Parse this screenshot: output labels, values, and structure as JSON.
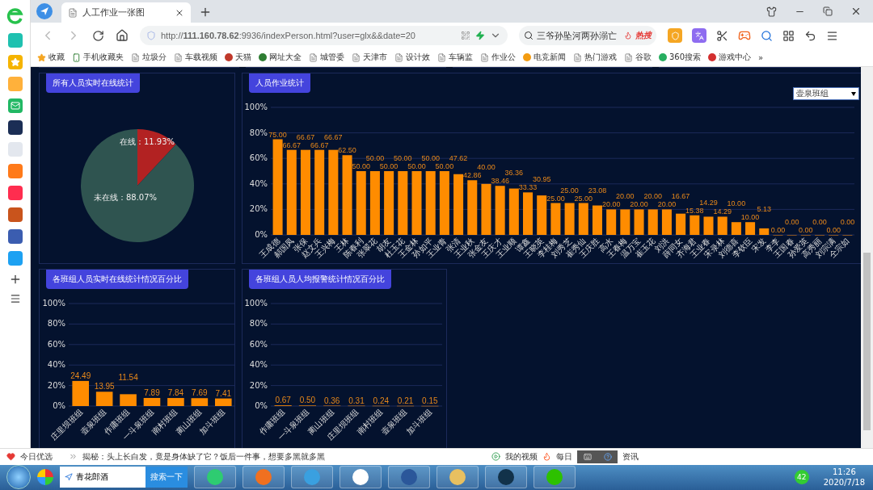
{
  "browser": {
    "tab": {
      "title": "人工作业一张图"
    },
    "address": "http://**111.160.78.62**:9936/indexPerson.html?user=glx&&date=20",
    "search": {
      "value": "三爷孙坠河两孙溺亡",
      "badge": "热搜"
    },
    "bookmarks": [
      {
        "kind": "star",
        "label": "收藏"
      },
      {
        "kind": "phone",
        "label": "手机收藏夹"
      },
      {
        "kind": "page",
        "label": "垃圾分"
      },
      {
        "kind": "page",
        "label": "车载视频"
      },
      {
        "kind": "site",
        "label": "天猫",
        "color": "#c0392b"
      },
      {
        "kind": "site",
        "label": "网址大全",
        "color": "#2e7d32"
      },
      {
        "kind": "page",
        "label": "城管委"
      },
      {
        "kind": "page",
        "label": "天津市"
      },
      {
        "kind": "page",
        "label": "设计效"
      },
      {
        "kind": "page",
        "label": "车辆监"
      },
      {
        "kind": "page",
        "label": "作业公"
      },
      {
        "kind": "site",
        "label": "电竞新闻",
        "color": "#f39c12"
      },
      {
        "kind": "page",
        "label": "热门游戏"
      },
      {
        "kind": "page",
        "label": "谷歌"
      },
      {
        "kind": "site",
        "label": "360搜索",
        "color": "#27ae60"
      },
      {
        "kind": "site",
        "label": "游戏中心",
        "color": "#d32f2f"
      }
    ],
    "more": "»"
  },
  "pie_panel": {
    "title": "所有人员实时在线统计",
    "chart_data": {
      "type": "pie",
      "categories": [
        "在线：11.93%",
        "未在线：88.07%"
      ],
      "values": [
        11.93,
        88.07
      ]
    }
  },
  "bar_panel": {
    "title": "人员作业统计",
    "select": {
      "value": "壶泉班组"
    },
    "chart_data": {
      "type": "bar",
      "grid": true,
      "ylim": [
        0,
        100
      ],
      "yticks": [
        {
          "value": 0,
          "label": "0%"
        },
        {
          "value": 20,
          "label": "20%"
        },
        {
          "value": 40,
          "label": "40%"
        },
        {
          "value": 60,
          "label": "60%"
        },
        {
          "value": 80,
          "label": "80%"
        },
        {
          "value": 100,
          "label": "100%"
        }
      ],
      "categories": [
        "王成德",
        "郝国凤",
        "张保",
        "赵文兵",
        "王兴梅",
        "王林",
        "陈春利",
        "张翠花",
        "胡友",
        "杜玉花",
        "王金林",
        "孙如平",
        "王业青",
        "张清",
        "王业秋",
        "张金友",
        "王庆才",
        "王业顺",
        "谭鑫",
        "王晓英",
        "李桂梅",
        "刘秀芝",
        "崔秀仙",
        "王庆胜",
        "高水",
        "王春梅",
        "温万宝",
        "崔玉花",
        "刘洪",
        "薛同女",
        "齐海君",
        "王业春",
        "宋录林",
        "刘德喜",
        "李钦臣",
        "宋发",
        "李李",
        "王国春",
        "孙爱英",
        "高秀丽",
        "刘宗满",
        "仝宗如"
      ],
      "values": [
        75.0,
        66.67,
        66.67,
        66.67,
        66.67,
        62.5,
        50.0,
        50.0,
        50.0,
        50.0,
        50.0,
        50.0,
        50.0,
        47.62,
        42.86,
        40.0,
        38.46,
        36.36,
        33.33,
        30.95,
        25.0,
        25.0,
        25.0,
        23.08,
        20.0,
        20.0,
        20.0,
        20.0,
        20.0,
        16.67,
        15.38,
        14.29,
        14.29,
        10.0,
        10.0,
        5.13,
        0.0,
        0.0,
        0.0,
        0.0,
        0.0,
        0.0
      ],
      "value_labels": [
        "75.00",
        "66.67",
        "66.67",
        "66.67",
        "66.67",
        "62.50",
        "50.00",
        "50.00",
        "50.00",
        "50.00",
        "50.00",
        "50.00",
        "50.00",
        "47.62",
        "42.86",
        "40.00",
        "38.46",
        "36.36",
        "33.33",
        "30.95",
        "25.00",
        "25.00",
        "25.00",
        "23.08",
        "20.00",
        "20.00",
        "20.00",
        "20.00",
        "20.00",
        "16.67",
        "15.38",
        "14.29",
        "14.29",
        "10.00",
        "10.00",
        "5.13",
        "0.00",
        "0.00",
        "0.00",
        "0.00",
        "0.00",
        "0.00"
      ]
    }
  },
  "online_panel": {
    "title": "各班组人员实时在线统计情况百分比",
    "chart_data": {
      "type": "bar",
      "grid": true,
      "ylim": [
        0,
        100
      ],
      "yticks": [
        {
          "value": 0,
          "label": "0%"
        },
        {
          "value": 20,
          "label": "20%"
        },
        {
          "value": 40,
          "label": "40%"
        },
        {
          "value": 60,
          "label": "60%"
        },
        {
          "value": 80,
          "label": "80%"
        },
        {
          "value": 100,
          "label": "100%"
        }
      ],
      "categories": [
        "庄里坝班组",
        "壶泉班组",
        "作庸班组",
        "一斗泉班组",
        "南村班组",
        "蔺山班组",
        "加斗班组"
      ],
      "values": [
        24.49,
        13.95,
        11.54,
        7.89,
        7.84,
        7.69,
        7.41
      ],
      "value_labels": [
        "24.49",
        "13.95",
        "11.54",
        "7.89",
        "7.84",
        "7.69",
        "7.41"
      ]
    }
  },
  "alarm_panel": {
    "title": "各班组人员人均报警统计情况百分比",
    "chart_data": {
      "type": "bar",
      "grid": true,
      "ylim": [
        0,
        100
      ],
      "yticks": [
        {
          "value": 0,
          "label": "0%"
        },
        {
          "value": 20,
          "label": "20%"
        },
        {
          "value": 40,
          "label": "40%"
        },
        {
          "value": 60,
          "label": "60%"
        },
        {
          "value": 80,
          "label": "80%"
        },
        {
          "value": 100,
          "label": "100%"
        }
      ],
      "categories": [
        "作庸班组",
        "一斗泉班组",
        "蔺山班组",
        "庄里坝班组",
        "南村班组",
        "壶泉班组",
        "加斗班组"
      ],
      "values": [
        0.67,
        0.5,
        0.36,
        0.31,
        0.24,
        0.21,
        0.15
      ],
      "value_labels": [
        "0.67",
        "0.50",
        "0.36",
        "0.31",
        "0.24",
        "0.21",
        "0.15"
      ]
    }
  },
  "status_bar": {
    "left": "今日优选",
    "news": "揭秘：头上长白发，竟是身体缺了它？饭后一件事，想要多黑就多黑",
    "video": "我的视频",
    "daily": "每日",
    "info": "资讯"
  },
  "taskbar": {
    "search": "青花郎酒",
    "search_button": "搜索一下",
    "badge": "42",
    "time": "11:26",
    "date": "2020/7/18"
  }
}
